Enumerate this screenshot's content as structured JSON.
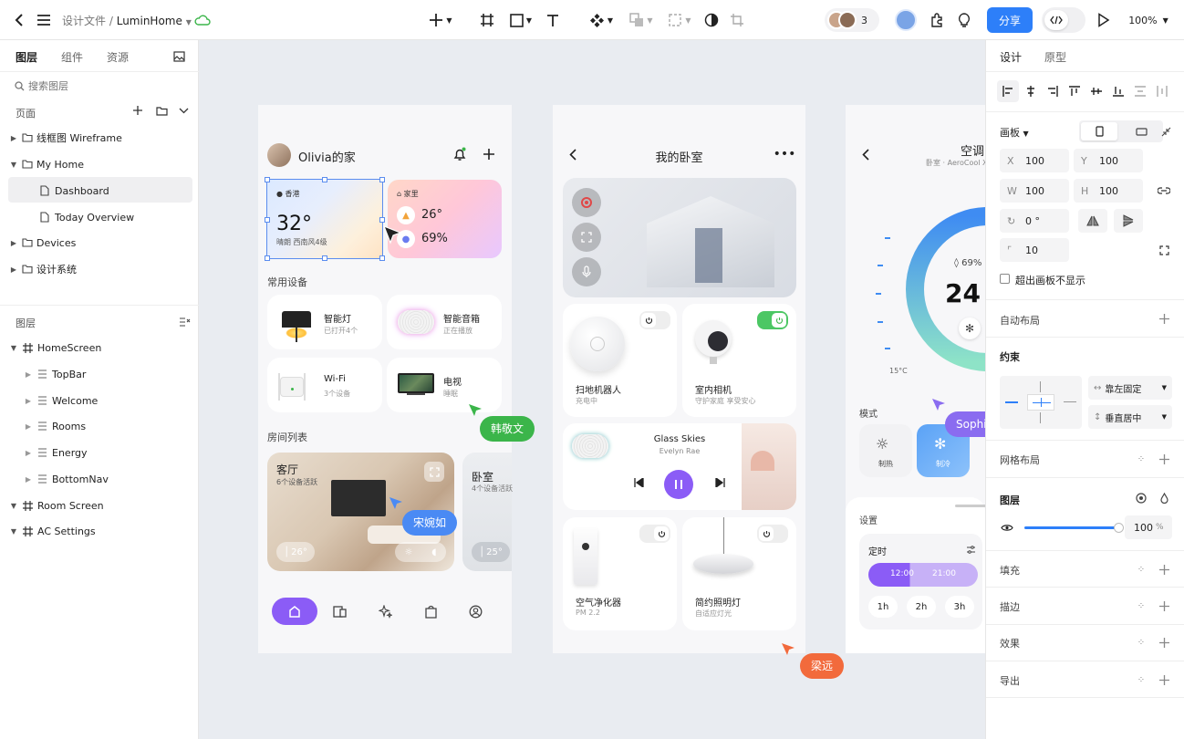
{
  "header": {
    "breadcrumb_root": "设计文件",
    "breadcrumb_sep": "/",
    "project_name": "LuminHome",
    "collaborator_count": "3",
    "share_label": "分享",
    "zoom": "100%"
  },
  "left_panel": {
    "tabs": [
      "图层",
      "组件",
      "资源"
    ],
    "search_placeholder": "搜索图层",
    "pages_title": "页面",
    "pages": [
      "线框图 Wireframe",
      "My Home",
      "Dashboard",
      "Today Overview",
      "Devices",
      "设计系统"
    ],
    "layers_title": "图层",
    "layers": [
      "HomeScreen",
      "TopBar",
      "Welcome",
      "Rooms",
      "Energy",
      "BottomNav",
      "Room Screen",
      "AC Settings"
    ]
  },
  "frame1": {
    "home_title": "Olivia的家",
    "weather_city": "香港",
    "temp": "32°",
    "weather_desc": "晴朗 西南风4级",
    "indoor_label": "家里",
    "indoor_temp": "26°",
    "indoor_humidity": "69%",
    "devices_title": "常用设备",
    "devices": [
      {
        "name": "智能灯",
        "status": "已打开4个"
      },
      {
        "name": "智能音箱",
        "status": "正在播放"
      },
      {
        "name": "Wi-Fi",
        "status": "3个设备"
      },
      {
        "name": "电视",
        "status": "睡眠"
      }
    ],
    "rooms_title": "房间列表",
    "room1_name": "客厅",
    "room1_sub": "6个设备活跃",
    "room1_temp": "26°",
    "room2_name": "卧室",
    "room2_sub": "4个设备活跃",
    "room2_temp": "25°"
  },
  "frame2": {
    "title": "我的卧室",
    "device1_name": "扫地机器人",
    "device1_status": "充电中",
    "device2_name": "室内相机",
    "device2_status": "守护家庭 享受安心",
    "song_title": "Glass Skies",
    "song_artist": "Evelyn Rae",
    "device3_name": "空气净化器",
    "device3_status": "PM 2.2",
    "device4_name": "简约照明灯",
    "device4_status": "自适应灯光"
  },
  "frame3": {
    "title": "空调",
    "subtitle": "卧室 · AeroCool X-",
    "humidity": "69%",
    "temp": "24",
    "min_temp": "15°C",
    "mode_title": "模式",
    "mode_heat": "制热",
    "mode_cool": "制冷",
    "settings_title": "设置",
    "timer_title": "定时",
    "timer_start": "12:00",
    "timer_end": "21:00",
    "durations": [
      "1h",
      "2h",
      "3h"
    ]
  },
  "cursors": [
    {
      "name": "韩敬文",
      "color": "#3bb54a"
    },
    {
      "name": "宋婉如",
      "color": "#4a8af4"
    },
    {
      "name": "梁远",
      "color": "#f26a3c"
    },
    {
      "name": "Sophie",
      "color": "#8a6cf0"
    }
  ],
  "right_panel": {
    "tabs": [
      "设计",
      "原型"
    ],
    "artboard_label": "画板",
    "x_label": "X",
    "x_value": "100",
    "y_label": "Y",
    "y_value": "100",
    "w_label": "W",
    "w_value": "100",
    "h_label": "H",
    "h_value": "100",
    "rotation": "0 °",
    "radius": "10",
    "clip_label": "超出画板不显示",
    "autolayout_label": "自动布局",
    "constraints_label": "约束",
    "constraint_h": "靠左固定",
    "constraint_v": "垂直居中",
    "grid_label": "网格布局",
    "layer_label": "图层",
    "opacity": "100",
    "opacity_unit": "%",
    "fill_label": "填充",
    "stroke_label": "描边",
    "effects_label": "效果",
    "export_label": "导出"
  },
  "colors": {
    "accent_blue": "#2d7ff9",
    "purple": "#8b5cf6",
    "selection": "#5b8def"
  }
}
